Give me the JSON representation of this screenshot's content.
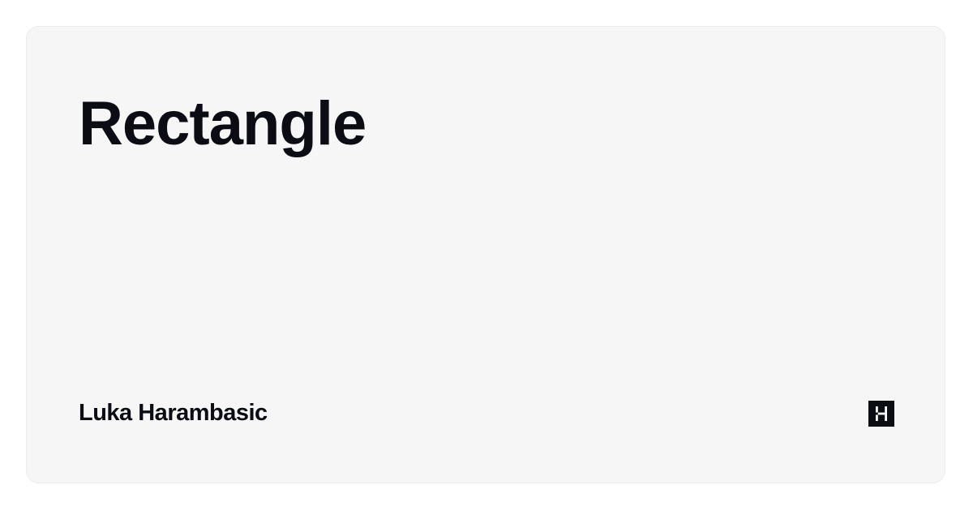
{
  "card": {
    "title": "Rectangle",
    "author": "Luka Harambasic",
    "logo_icon": "logo-h-icon"
  },
  "colors": {
    "page_background": "#ffffff",
    "card_background": "#f6f6f6",
    "text": "#0b0c14"
  }
}
